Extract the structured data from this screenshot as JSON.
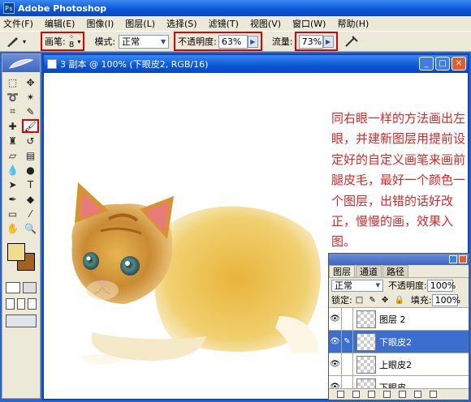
{
  "app": {
    "title": "Adobe Photoshop",
    "logo": "Ps"
  },
  "menu": [
    "文件(F)",
    "编辑(E)",
    "图像(I)",
    "图层(L)",
    "选择(S)",
    "滤镜(T)",
    "视图(V)",
    "窗口(W)",
    "帮助(H)"
  ],
  "options": {
    "brush_label": "画笔:",
    "brush_size": "8",
    "mode_label": "模式:",
    "mode_value": "正常",
    "opacity_label": "不透明度:",
    "opacity_value": "63%",
    "flow_label": "流量:",
    "flow_value": "73%"
  },
  "document": {
    "title": "3 副本 @ 100% (下眼皮2, RGB/16)",
    "note": "同右眼一样的方法画出左眼，并建新图层用提前设定好的自定义画笔来画前腿皮毛，最好一个颜色一个图层，出错的话好改正，慢慢的画，效果入图。"
  },
  "colors": {
    "foreground": "#f2dd8c",
    "background": "#a0641e",
    "accent_box": "#e00000"
  },
  "layers_panel": {
    "tabs": [
      "图层",
      "通道",
      "路径"
    ],
    "blend_mode": "正常",
    "opacity_label": "不透明度:",
    "opacity_value": "100%",
    "lock_label": "锁定:",
    "fill_label": "填充:",
    "fill_value": "100%",
    "layers": [
      "图层 2",
      "下眼皮2",
      "上眼皮2",
      "下眼皮"
    ],
    "selected_index": 1
  }
}
